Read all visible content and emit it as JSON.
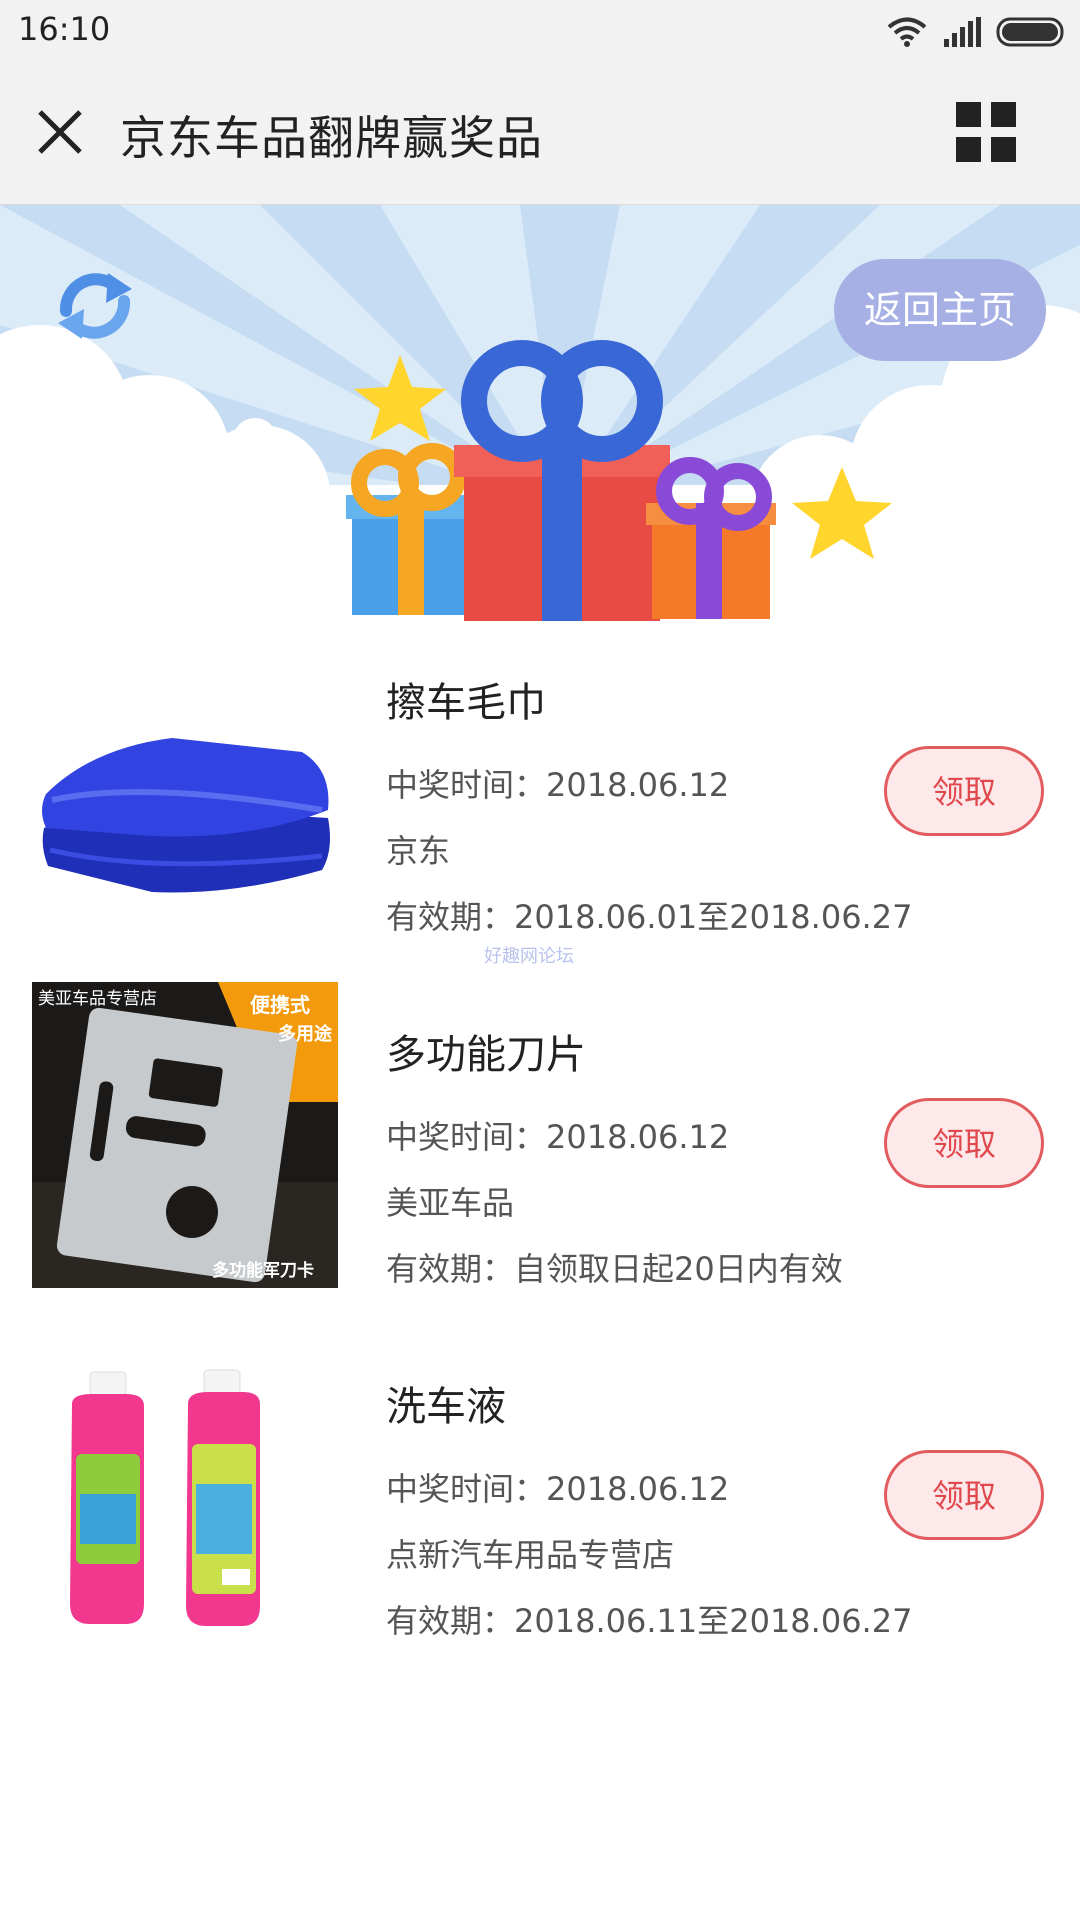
{
  "status_bar": {
    "time": "16:10"
  },
  "header": {
    "title": "京东车品翻牌赢奖品"
  },
  "banner": {
    "home_label": "返回主页"
  },
  "prizes": [
    {
      "name": "擦车毛巾",
      "win_time": "中奖时间：2018.06.12",
      "shop": "京东",
      "validity": "有效期：2018.06.01至2018.06.27",
      "claim_label": "领取",
      "image": "blue-towel"
    },
    {
      "name": "多功能刀片",
      "win_time": "中奖时间：2018.06.12",
      "shop": "美亚车品",
      "validity": "有效期：自领取日起20日内有效",
      "claim_label": "领取",
      "image": "multi-tool-card",
      "image_text": {
        "store": "美亚车品专营店",
        "tag_line1": "便携式",
        "tag_line2": "多用途",
        "caption": "多功能军刀卡"
      }
    },
    {
      "name": "洗车液",
      "win_time": "中奖时间：2018.06.12",
      "shop": "点新汽车用品专营店",
      "validity": "有效期：2018.06.11至2018.06.27",
      "claim_label": "领取",
      "image": "pink-washer-fluid-bottles"
    }
  ],
  "watermark": "好趣网论坛",
  "colors": {
    "accent": "#e25b5f",
    "home_button": "#a6b0e4",
    "towel": "#2f3fd6"
  }
}
